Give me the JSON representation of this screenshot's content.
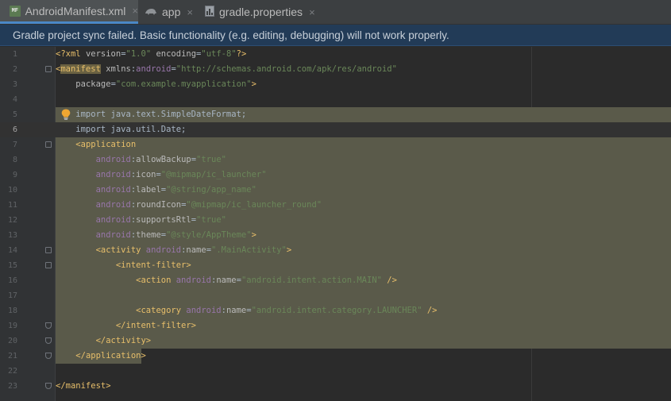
{
  "tabs": [
    {
      "label": "AndroidManifest.xml",
      "icon": "manifest-file-icon",
      "active": true
    },
    {
      "label": "app",
      "icon": "gradle-module-icon",
      "active": false
    },
    {
      "label": "gradle.properties",
      "icon": "gradle-properties-icon",
      "active": false
    }
  ],
  "tab_close_glyph": "×",
  "tab_icon_text": "MF",
  "banner": {
    "message": "Gradle project sync failed. Basic functionality (e.g. editing, debugging) will not work properly."
  },
  "editor": {
    "lines": [
      {
        "n": "1",
        "segs": [
          [
            "tag",
            "<?xml "
          ],
          [
            "attr",
            "version"
          ],
          [
            "txt",
            "="
          ],
          [
            "str",
            "\"1.0\""
          ],
          [
            "txt",
            " "
          ],
          [
            "attr",
            "encoding"
          ],
          [
            "txt",
            "="
          ],
          [
            "str",
            "\"utf-8\""
          ],
          [
            "tag",
            "?>"
          ]
        ]
      },
      {
        "n": "2",
        "segs": [
          [
            "tag",
            "<"
          ],
          [
            "taghl",
            "manifest"
          ],
          [
            "txt",
            " "
          ],
          [
            "attr",
            "xmlns"
          ],
          [
            "txt",
            ":"
          ],
          [
            "ns",
            "android"
          ],
          [
            "txt",
            "="
          ],
          [
            "str",
            "\"http://schemas.android.com/apk/res/android\""
          ]
        ]
      },
      {
        "n": "3",
        "segs": [
          [
            "txt",
            "    "
          ],
          [
            "attr",
            "package"
          ],
          [
            "txt",
            "="
          ],
          [
            "str",
            "\"com.example.myapplication\""
          ],
          [
            "tag",
            ">"
          ]
        ]
      },
      {
        "n": "4",
        "segs": []
      },
      {
        "n": "5",
        "segs": [
          [
            "txt",
            "    import java.text.SimpleDateFormat;"
          ]
        ]
      },
      {
        "n": "6",
        "segs": [
          [
            "txt",
            "    import java.util.Date;"
          ]
        ]
      },
      {
        "n": "7",
        "segs": [
          [
            "txt",
            "    "
          ],
          [
            "tag",
            "<application"
          ]
        ]
      },
      {
        "n": "8",
        "segs": [
          [
            "txt",
            "        "
          ],
          [
            "ns",
            "android"
          ],
          [
            "txt",
            ":"
          ],
          [
            "attr",
            "allowBackup"
          ],
          [
            "txt",
            "="
          ],
          [
            "str",
            "\"true\""
          ]
        ]
      },
      {
        "n": "9",
        "segs": [
          [
            "txt",
            "        "
          ],
          [
            "ns",
            "android"
          ],
          [
            "txt",
            ":"
          ],
          [
            "attr",
            "icon"
          ],
          [
            "txt",
            "="
          ],
          [
            "str",
            "\"@mipmap/ic_launcher\""
          ]
        ]
      },
      {
        "n": "10",
        "segs": [
          [
            "txt",
            "        "
          ],
          [
            "ns",
            "android"
          ],
          [
            "txt",
            ":"
          ],
          [
            "attr",
            "label"
          ],
          [
            "txt",
            "="
          ],
          [
            "str",
            "\"@string/app_name\""
          ]
        ]
      },
      {
        "n": "11",
        "segs": [
          [
            "txt",
            "        "
          ],
          [
            "ns",
            "android"
          ],
          [
            "txt",
            ":"
          ],
          [
            "attr",
            "roundIcon"
          ],
          [
            "txt",
            "="
          ],
          [
            "str",
            "\"@mipmap/ic_launcher_round\""
          ]
        ]
      },
      {
        "n": "12",
        "segs": [
          [
            "txt",
            "        "
          ],
          [
            "ns",
            "android"
          ],
          [
            "txt",
            ":"
          ],
          [
            "attr",
            "supportsRtl"
          ],
          [
            "txt",
            "="
          ],
          [
            "str",
            "\"true\""
          ]
        ]
      },
      {
        "n": "13",
        "segs": [
          [
            "txt",
            "        "
          ],
          [
            "ns",
            "android"
          ],
          [
            "txt",
            ":"
          ],
          [
            "attr",
            "theme"
          ],
          [
            "txt",
            "="
          ],
          [
            "str",
            "\"@style/AppTheme\""
          ],
          [
            "tag",
            ">"
          ]
        ]
      },
      {
        "n": "14",
        "segs": [
          [
            "txt",
            "        "
          ],
          [
            "tag",
            "<activity "
          ],
          [
            "ns",
            "android"
          ],
          [
            "txt",
            ":"
          ],
          [
            "attr",
            "name"
          ],
          [
            "txt",
            "="
          ],
          [
            "str",
            "\".MainActivity\""
          ],
          [
            "tag",
            ">"
          ]
        ]
      },
      {
        "n": "15",
        "segs": [
          [
            "txt",
            "            "
          ],
          [
            "tag",
            "<intent-filter>"
          ]
        ]
      },
      {
        "n": "16",
        "segs": [
          [
            "txt",
            "                "
          ],
          [
            "tag",
            "<action "
          ],
          [
            "ns",
            "android"
          ],
          [
            "txt",
            ":"
          ],
          [
            "attr",
            "name"
          ],
          [
            "txt",
            "="
          ],
          [
            "str",
            "\"android.intent.action.MAIN\""
          ],
          [
            "tag",
            " />"
          ]
        ]
      },
      {
        "n": "17",
        "segs": []
      },
      {
        "n": "18",
        "segs": [
          [
            "txt",
            "                "
          ],
          [
            "tag",
            "<category "
          ],
          [
            "ns",
            "android"
          ],
          [
            "txt",
            ":"
          ],
          [
            "attr",
            "name"
          ],
          [
            "txt",
            "="
          ],
          [
            "str",
            "\"android.intent.category.LAUNCHER\""
          ],
          [
            "tag",
            " />"
          ]
        ]
      },
      {
        "n": "19",
        "segs": [
          [
            "txt",
            "            "
          ],
          [
            "tag",
            "</intent-filter>"
          ]
        ]
      },
      {
        "n": "20",
        "segs": [
          [
            "txt",
            "        "
          ],
          [
            "tag",
            "</activity>"
          ]
        ]
      },
      {
        "n": "21",
        "segs": [
          [
            "txt",
            "    "
          ],
          [
            "tag",
            "</application>"
          ]
        ]
      },
      {
        "n": "22",
        "segs": []
      },
      {
        "n": "23",
        "segs": [
          [
            "tag",
            "</manifest>"
          ]
        ]
      }
    ],
    "caret_line": "6",
    "intention_bulb_line": "5",
    "fold_open_lines": [
      "2",
      "7",
      "14",
      "15"
    ],
    "fold_close_lines": [
      "19",
      "20",
      "21",
      "23"
    ],
    "selection_lines": [
      "5",
      "21"
    ]
  },
  "colors": {
    "background": "#2b2b2b",
    "tag": "#e8bf6a",
    "attribute": "#bababa",
    "namespace": "#9876aa",
    "string": "#6a8759",
    "selection": "#5a5a4a",
    "banner": "#223b57"
  }
}
